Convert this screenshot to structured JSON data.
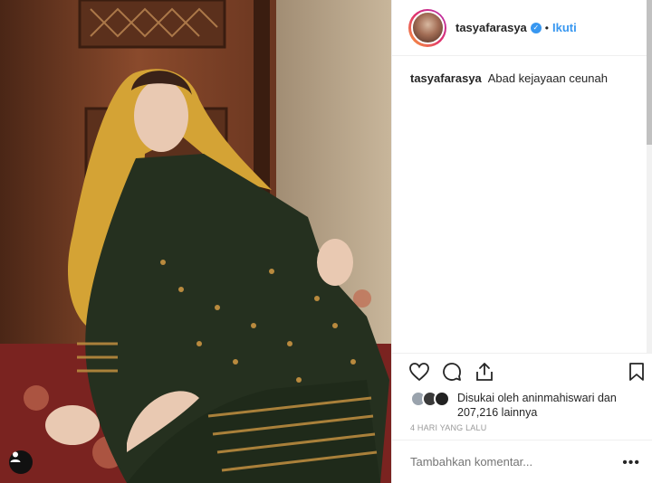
{
  "post": {
    "username": "tasyafarasya",
    "verified": true,
    "separator": "•",
    "follow_label": "Ikuti",
    "caption": {
      "username": "tasyafarasya",
      "text": "Abad kejayaan ceunah"
    },
    "likes": {
      "prefix": "Disukai oleh",
      "liked_by": "aninmahiswari",
      "middle": "dan",
      "count": "207,216",
      "suffix": "lainnya"
    },
    "timestamp": "4 HARI YANG LALU",
    "comment_placeholder": "Tambahkan komentar...",
    "more_label": "•••"
  },
  "icons": {
    "like": "heart-icon",
    "comment": "comment-icon",
    "share": "share-icon",
    "save": "bookmark-icon",
    "tag": "person-tag-icon"
  },
  "colors": {
    "accent": "#3897f0",
    "text": "#262626",
    "muted": "#999999",
    "border": "#efefef"
  }
}
